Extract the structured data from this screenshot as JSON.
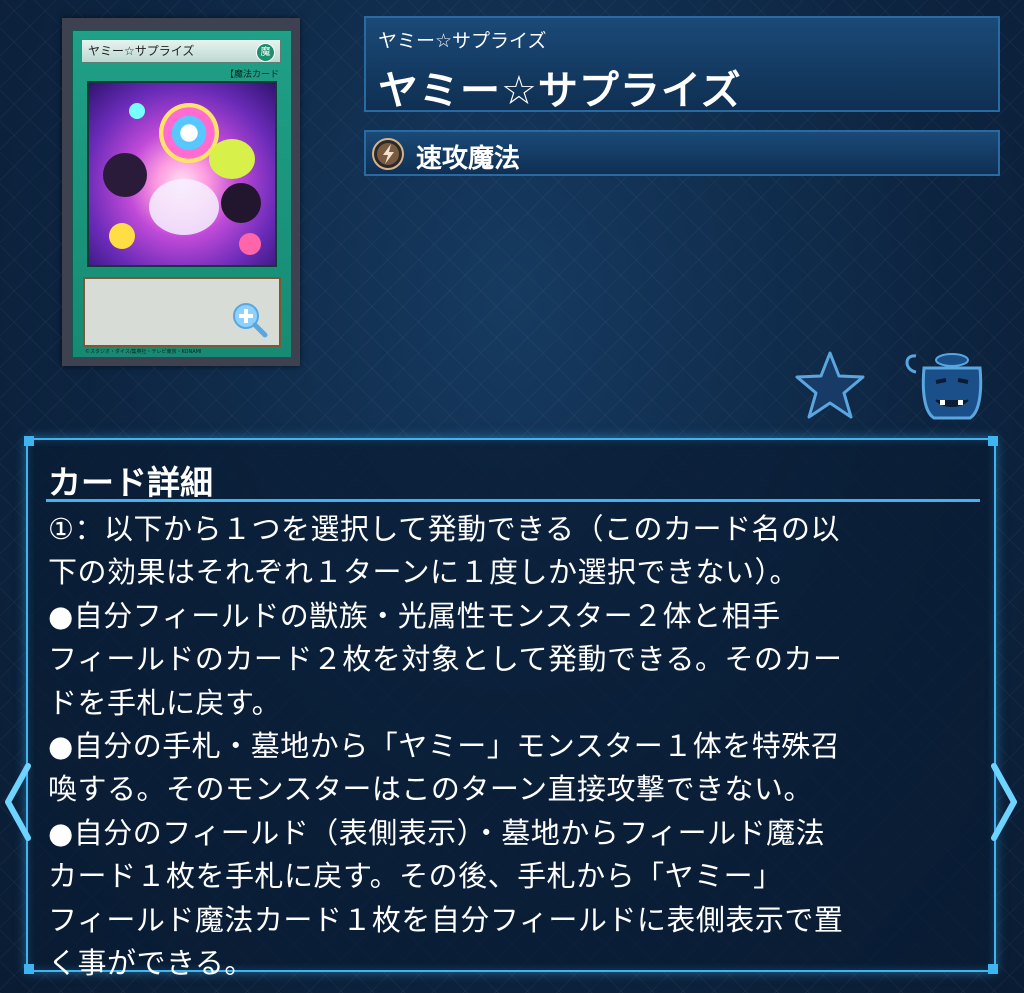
{
  "card": {
    "frame_name": "ヤミー☆サプライズ",
    "attribute_glyph": "魔",
    "type_line": "【魔法カード",
    "copyright": "©スタジオ・ダイス/集英社・テレビ東京・KONAMI"
  },
  "title": {
    "ruby": "ヤミー☆サプライズ",
    "name": "ヤミー☆サプライズ"
  },
  "type": {
    "label": "速攻魔法",
    "icon": "quick-play-icon"
  },
  "actions": {
    "favorite_icon": "star-icon",
    "pot_icon": "pot-of-greed-icon"
  },
  "details": {
    "heading": "カード詳細",
    "text": "①：以下から１つを選択して発動できる（このカード名の以\n下の効果はそれぞれ１ターンに１度しか選択できない）。\n●自分フィールドの獣族・光属性モンスター２体と相手\nフィールドのカード２枚を対象として発動できる。そのカー\nドを手札に戻す。\n●自分の手札・墓地から「ヤミー」モンスター１体を特殊召\n喚する。そのモンスターはこのターン直接攻撃できない。\n●自分のフィールド（表側表示）・墓地からフィールド魔法\nカード１枚を手札に戻す。その後、手札から「ヤミー」\nフィールド魔法カード１枚を自分フィールドに表側表示で置\nく事ができる。"
  },
  "colors": {
    "accent": "#3fb4f0",
    "background": "#0d2440",
    "card_frame": "#1fa087"
  }
}
